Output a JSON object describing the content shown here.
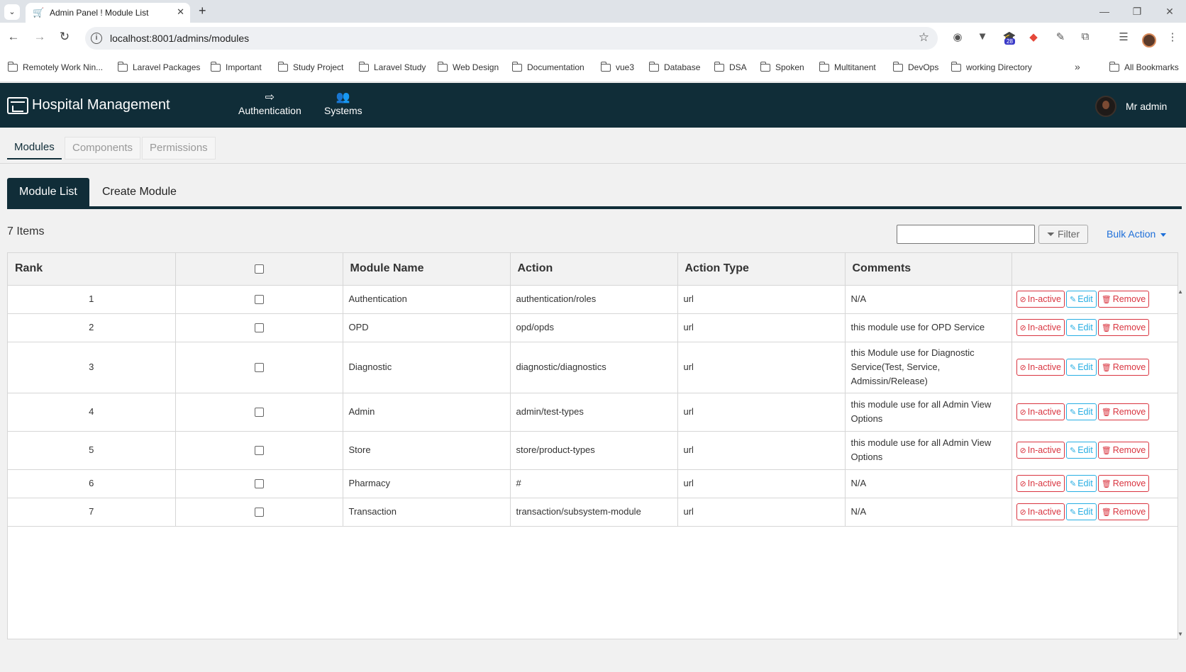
{
  "browser": {
    "tab_title": "Admin Panel ! Module List",
    "new_tab": "+",
    "url": "localhost:8001/admins/modules",
    "extension_badge": "28",
    "bookmarks": [
      "Remotely Work Nin...",
      "Laravel Packages",
      "Important",
      "Study Project",
      "Laravel Study",
      "Web Design",
      "Documentation",
      "vue3",
      "Database",
      "DSA",
      "Spoken",
      "Multitanent",
      "DevOps",
      "working Directory"
    ],
    "bookmarks_more": "»",
    "all_bookmarks": "All Bookmarks"
  },
  "app": {
    "brand": "Hospital Management",
    "menu": [
      {
        "label": "Authentication",
        "icon": "sign-out-icon"
      },
      {
        "label": "Systems",
        "icon": "users-icon"
      }
    ],
    "user": "Mr admin"
  },
  "subnav": {
    "tabs": [
      "Modules",
      "Components",
      "Permissions"
    ],
    "active": "Modules"
  },
  "page_tabs": {
    "tabs": [
      "Module List",
      "Create Module"
    ],
    "active": "Module List"
  },
  "list": {
    "items_label": "7 Items",
    "search_value": "",
    "filter_label": "Filter",
    "bulk_action_label": "Bulk Action"
  },
  "table": {
    "columns": [
      "Rank",
      "",
      "Module Name",
      "Action",
      "Action Type",
      "Comments",
      ""
    ],
    "rows": [
      {
        "rank": "1",
        "name": "Authentication",
        "action": "authentication/roles",
        "type": "url",
        "comments": "N/A"
      },
      {
        "rank": "2",
        "name": "OPD",
        "action": "opd/opds",
        "type": "url",
        "comments": "this module use for OPD Service"
      },
      {
        "rank": "3",
        "name": "Diagnostic",
        "action": "diagnostic/diagnostics",
        "type": "url",
        "comments": "this Module use for Diagnostic Service(Test, Service, Admissin/Release)"
      },
      {
        "rank": "4",
        "name": "Admin",
        "action": "admin/test-types",
        "type": "url",
        "comments": "this module use for all Admin View Options"
      },
      {
        "rank": "5",
        "name": "Store",
        "action": "store/product-types",
        "type": "url",
        "comments": "this module use for all Admin View Options"
      },
      {
        "rank": "6",
        "name": "Pharmacy",
        "action": "#",
        "type": "url",
        "comments": "N/A"
      },
      {
        "rank": "7",
        "name": "Transaction",
        "action": "transaction/subsystem-module",
        "type": "url",
        "comments": "N/A"
      }
    ],
    "row_actions": {
      "inactive": "In-active",
      "edit": "Edit",
      "remove": "Remove"
    }
  },
  "colors": {
    "header_bg": "#102d38",
    "danger": "#d9343f",
    "info": "#27aee3",
    "link": "#1e6fd9"
  }
}
